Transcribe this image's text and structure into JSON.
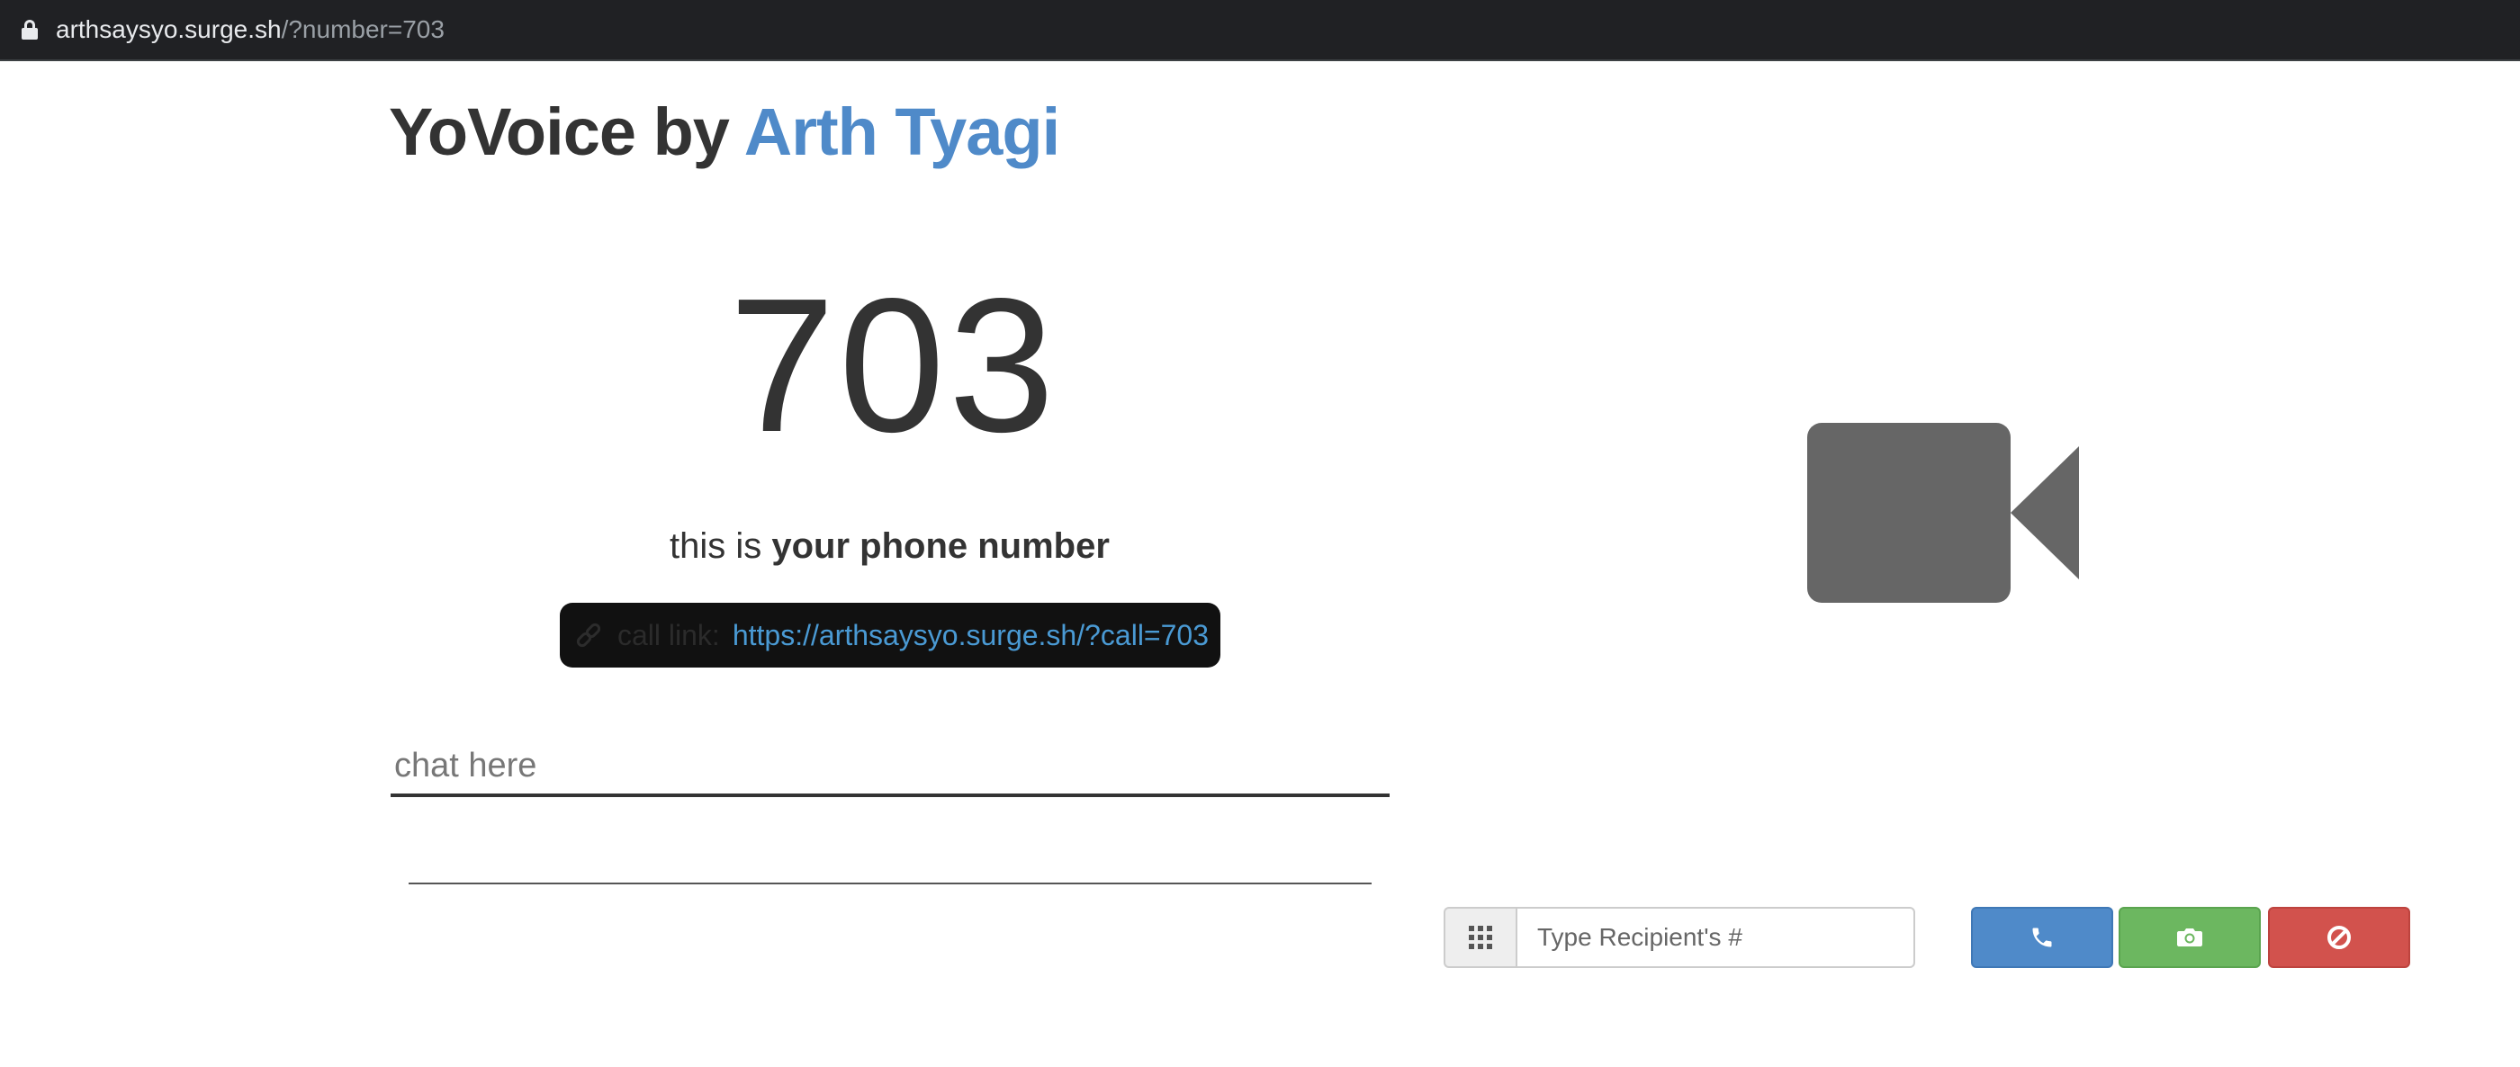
{
  "browser": {
    "url_domain": "arthsaysyo.surge.sh",
    "url_path": "/?number=703"
  },
  "header": {
    "title_prefix": "YoVoice by ",
    "author": "Arth Tyagi"
  },
  "phone": {
    "number": "703",
    "caption_prefix": "this is ",
    "caption_bold": "your phone number",
    "call_link_label": "call link:",
    "call_link_url": "https://arthsaysyo.surge.sh/?call=703"
  },
  "chat": {
    "placeholder": "chat here"
  },
  "dialer": {
    "recipient_placeholder": "Type Recipient's #"
  },
  "icons": {
    "lock": "lock-icon",
    "link": "link-icon",
    "video": "video-camera-icon",
    "dialpad": "dialpad-grid-icon",
    "call": "phone-icon",
    "camera": "camera-icon",
    "hangup": "ban-icon"
  },
  "colors": {
    "author": "#4f8ac9",
    "call_button": "#4f8ac9",
    "video_button": "#6cb760",
    "hangup_button": "#d2524d",
    "video_icon": "#666666"
  }
}
